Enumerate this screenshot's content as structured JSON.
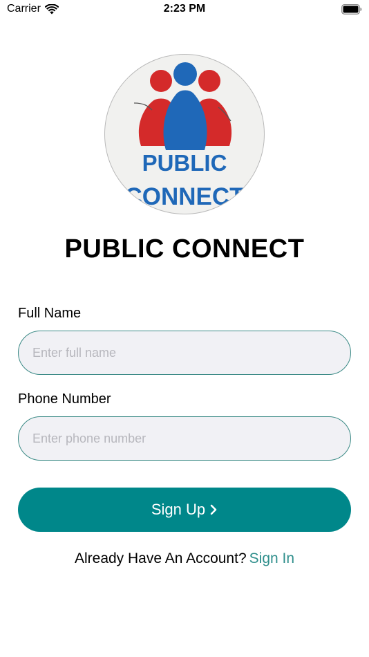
{
  "status_bar": {
    "carrier": "Carrier",
    "time": "2:23 PM",
    "wifi_icon": "wifi-icon",
    "battery_icon": "battery-icon"
  },
  "logo": {
    "line1": "PUBLIC",
    "line2": "CONNECT",
    "colors": {
      "red": "#d42a2a",
      "blue": "#1f68b8",
      "background": "#f1f1ef"
    }
  },
  "title": "PUBLIC CONNECT",
  "form": {
    "full_name": {
      "label": "Full Name",
      "placeholder": "Enter full name",
      "value": ""
    },
    "phone_number": {
      "label": "Phone Number",
      "placeholder": "Enter phone number",
      "value": ""
    }
  },
  "signup_button": {
    "label": "Sign Up",
    "icon": "chevron-right-icon",
    "color": "#00878a"
  },
  "signin": {
    "prompt": "Already Have An Account?",
    "link": "Sign In",
    "link_color": "#2f8f8c"
  }
}
